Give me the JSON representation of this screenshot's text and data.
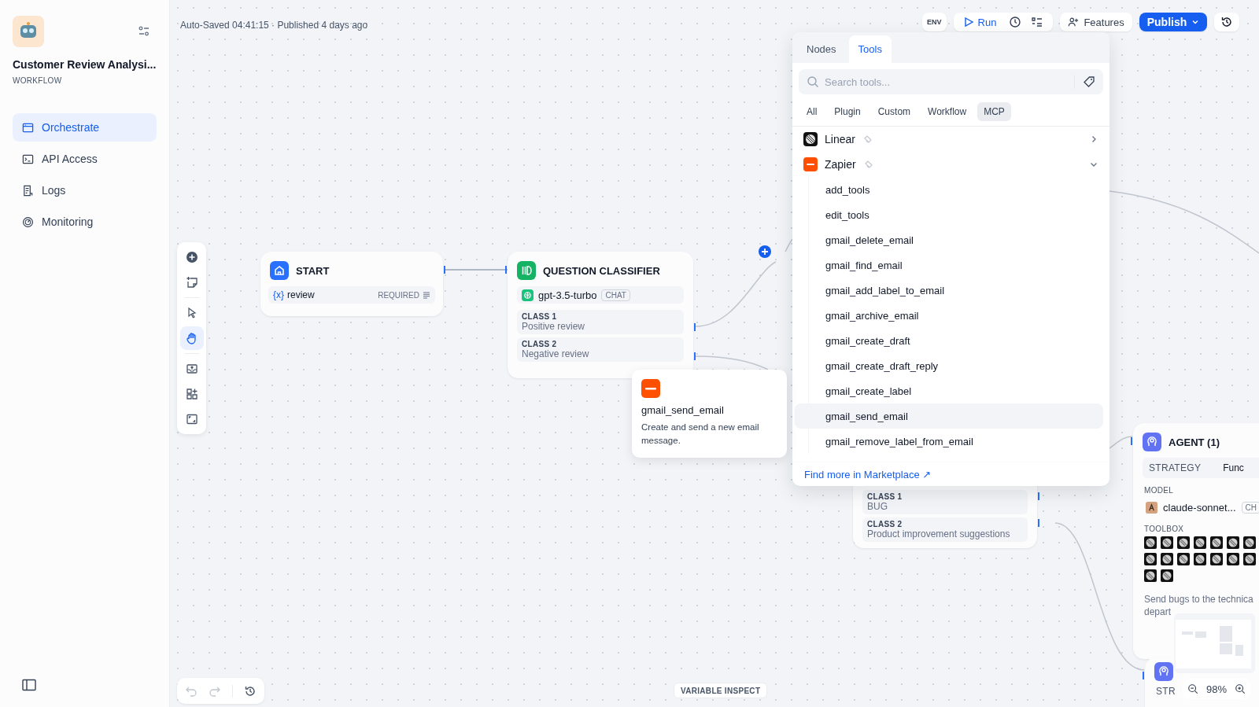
{
  "app": {
    "name": "Customer Review Analysi...",
    "type": "WORKFLOW"
  },
  "nav": [
    {
      "label": "Orchestrate",
      "selected": true,
      "kind": "orchestrate"
    },
    {
      "label": "API Access",
      "selected": false,
      "kind": "api"
    },
    {
      "label": "Logs",
      "selected": false,
      "kind": "logs"
    },
    {
      "label": "Monitoring",
      "selected": false,
      "kind": "monitoring"
    }
  ],
  "status": "Auto-Saved 04:41:15 · Published 4 days ago",
  "header": {
    "env": "ENV",
    "run": "Run",
    "features": "Features",
    "publish": "Publish"
  },
  "canvas_tools": [
    {
      "kind": "add",
      "selected": false
    },
    {
      "kind": "note",
      "selected": false
    },
    {
      "kind": "pointer",
      "selected": false
    },
    {
      "kind": "hand",
      "selected": true
    },
    {
      "kind": "export",
      "selected": false
    },
    {
      "kind": "organize",
      "selected": false
    },
    {
      "kind": "fit",
      "selected": false
    }
  ],
  "start_node": {
    "title": "START",
    "variable_prefix": "{x}",
    "variable": "review",
    "badge": "REQUIRED"
  },
  "classifier_node": {
    "title": "QUESTION CLASSIFIER",
    "model": "gpt-3.5-turbo",
    "model_mode": "CHAT",
    "classes": [
      {
        "label": "CLASS 1",
        "text": "Positive review"
      },
      {
        "label": "CLASS 2",
        "text": "Negative review"
      }
    ]
  },
  "classifier_node_2": {
    "classes": [
      {
        "label": "CLASS 1",
        "text": "BUG"
      },
      {
        "label": "CLASS 2",
        "text": "Product improvement suggestions"
      }
    ]
  },
  "agent_node": {
    "title": "AGENT (1)",
    "strategy_label": "STRATEGY",
    "strategy_value": "Func",
    "model_label": "MODEL",
    "model": "claude-sonnet...",
    "model_mode": "CH",
    "toolbox_label": "TOOLBOX",
    "description_lines": [
      "Send bugs to the technica",
      "depart"
    ]
  },
  "agent_node_2": {
    "strategy_label": "STR"
  },
  "tooltip": {
    "title": "gmail_send_email",
    "description": "Create and send a new email message."
  },
  "panel": {
    "tabs": [
      {
        "label": "Nodes",
        "selected": false
      },
      {
        "label": "Tools",
        "selected": true
      }
    ],
    "search": {
      "placeholder": "Search tools..."
    },
    "filters": [
      {
        "label": "All",
        "selected": false
      },
      {
        "label": "Plugin",
        "selected": false
      },
      {
        "label": "Custom",
        "selected": false
      },
      {
        "label": "Workflow",
        "selected": false
      },
      {
        "label": "MCP",
        "selected": true
      }
    ],
    "providers": [
      {
        "name": "Linear",
        "kind": "linear",
        "expanded": false
      },
      {
        "name": "Zapier",
        "kind": "zapier",
        "expanded": true,
        "tools": [
          {
            "name": "add_tools",
            "selected": false
          },
          {
            "name": "edit_tools",
            "selected": false
          },
          {
            "name": "gmail_delete_email",
            "selected": false
          },
          {
            "name": "gmail_find_email",
            "selected": false
          },
          {
            "name": "gmail_add_label_to_email",
            "selected": false
          },
          {
            "name": "gmail_archive_email",
            "selected": false
          },
          {
            "name": "gmail_create_draft",
            "selected": false
          },
          {
            "name": "gmail_create_draft_reply",
            "selected": false
          },
          {
            "name": "gmail_create_label",
            "selected": false
          },
          {
            "name": "gmail_send_email",
            "selected": true
          },
          {
            "name": "gmail_remove_label_from_email",
            "selected": false
          }
        ]
      }
    ],
    "link": "Find more in Marketplace",
    "link_arrow": "↗"
  },
  "variable_inspect": "VARIABLE INSPECT",
  "zoom": "98%"
}
